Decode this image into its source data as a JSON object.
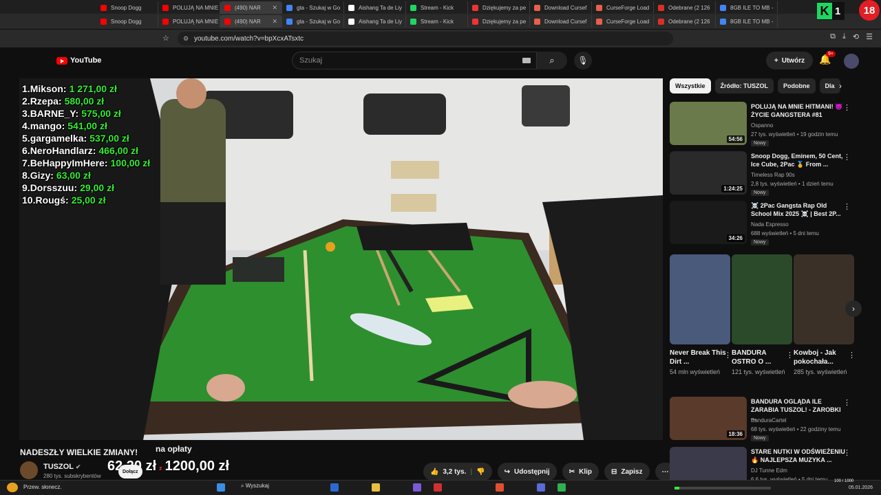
{
  "tabs_row1": [
    "Snoop Dogg",
    "POLUJĄ NA MNIE",
    "(490) NAR",
    "gta - Szukaj w Go",
    "Aishang Ta de Liy",
    "Stream - Kick",
    "Dziękujemy za pe",
    "Download Cursef",
    "CurseForge Load",
    "Odebrane (2 126",
    "8GB ILE TO MB -"
  ],
  "tabs_row2": [
    "Snoop Dogg",
    "POLUJĄ NA MNIE",
    "(490) NAR",
    "gta - Szukaj w Go",
    "Aishang Ta de Liy",
    "Stream - Kick",
    "Dziękujemy za pe",
    "Download Cursef",
    "CurseForge Load",
    "Odebrane (2 126",
    "8GB ILE TO MB -"
  ],
  "url": "youtube.com/watch?v=bpXcxATsxtc",
  "yt": {
    "logo": "YouTube",
    "search_placeholder": "Szukaj",
    "create": "Utwórz",
    "notif": "9+"
  },
  "overlay": {
    "leaderboard": [
      {
        "rank": "1.",
        "name": "Mikson:",
        "amount": "1 271,00 zł"
      },
      {
        "rank": "2.",
        "name": "Rzepa:",
        "amount": "580,00 zł"
      },
      {
        "rank": "3.",
        "name": "BARNE_Y:",
        "amount": "575,00 zł"
      },
      {
        "rank": "4.",
        "name": "mango:",
        "amount": "541,00 zł"
      },
      {
        "rank": "5.",
        "name": "gargamelka:",
        "amount": "537,00 zł"
      },
      {
        "rank": "6.",
        "name": "NeroHandlarz:",
        "amount": "466,00 zł"
      },
      {
        "rank": "7.",
        "name": "BeHappyImHere:",
        "amount": "100,00 zł"
      },
      {
        "rank": "8.",
        "name": "Gizy:",
        "amount": "63,00 zł"
      },
      {
        "rank": "9.",
        "name": "Dorsszuu:",
        "amount": "29,00 zł"
      },
      {
        "rank": "10.",
        "name": "Rougś:",
        "amount": "25,00 zł"
      }
    ],
    "k_count": "1",
    "age_badge": "18",
    "fee_label": "na opłaty",
    "donation_current": "62,20 zł",
    "donation_sep": "z",
    "donation_goal": "1200,00 zł",
    "progress_fraction": 0.052,
    "progress_text": "100 / 1000"
  },
  "video": {
    "title": "NADESZŁY WIELKIE ZMIANY!",
    "channel": "TUSZOL",
    "subs": "280 tys. subskrybentów",
    "join": "Dołącz",
    "likes": "3,2 tys.",
    "share": "Udostępnij",
    "clip": "Klip",
    "save": "Zapisz"
  },
  "chips": [
    "Wszystkie",
    "Źródło: TUSZOL",
    "Podobne",
    "Dla"
  ],
  "related": [
    {
      "title": "POLUJĄ NA MNIE HITMANI! 👿 ŻYCIE GANGSTERA #81",
      "channel": "Ospanno",
      "meta": "27 tys. wyświetleń • 19 godzin temu",
      "duration": "54:56",
      "badge": "Nowy",
      "thumb": "#6b7a4a"
    },
    {
      "title": "Snoop Dogg, Eminem, 50 Cent, Ice Cube, 2Pac 🏅 From ...",
      "channel": "Timeless Rap 90s",
      "meta": "2,8 tys. wyświetleń • 1 dzień temu",
      "duration": "1:24:25",
      "badge": "Nowy",
      "thumb": "#2a2a2a"
    },
    {
      "title": "☠️ 2Pac Gangsta Rap Old School Mix 2025 ☠️ | Best 2P...",
      "channel": "Nada Espresso",
      "meta": "688 wyświetleń • 5 dni temu",
      "duration": "34:26",
      "badge": "Nowy",
      "thumb": "#1a1a1a"
    },
    {
      "title": "BANDURA OGLĄDA ILE ZARABIA TUSZOL! - ZAROBKI ...",
      "channel": "BanduraCartel",
      "meta": "68 tys. wyświetleń • 22 godziny temu",
      "duration": "18:36",
      "badge": "Nowy",
      "thumb": "#5a3a2a"
    },
    {
      "title": "STARE NUTKI W ODŚWIEŻENIU 🔥 NAJLEPSZA MUZYKA ...",
      "channel": "DJ Tunne Edm",
      "meta": "6,6 tys. wyświetleń • 5 dni temu",
      "duration": "",
      "badge": "",
      "thumb": "#3a3a4a"
    }
  ],
  "shorts": [
    {
      "title": "Never Break This Dirt ...",
      "views": "54 mln wyświetleń",
      "thumb": "#4a5a7a"
    },
    {
      "title": "BANDURA OSTRO O ...",
      "views": "121 tys. wyświetleń",
      "thumb": "#2a4a2a"
    },
    {
      "title": "Kowboj - Jak pokochała...",
      "views": "285 tys. wyświetleń",
      "thumb": "#3a3028"
    }
  ],
  "taskbar": {
    "weather": "Przew. słonecz.",
    "search": "Wyszukaj",
    "date": "05.01.2026"
  }
}
